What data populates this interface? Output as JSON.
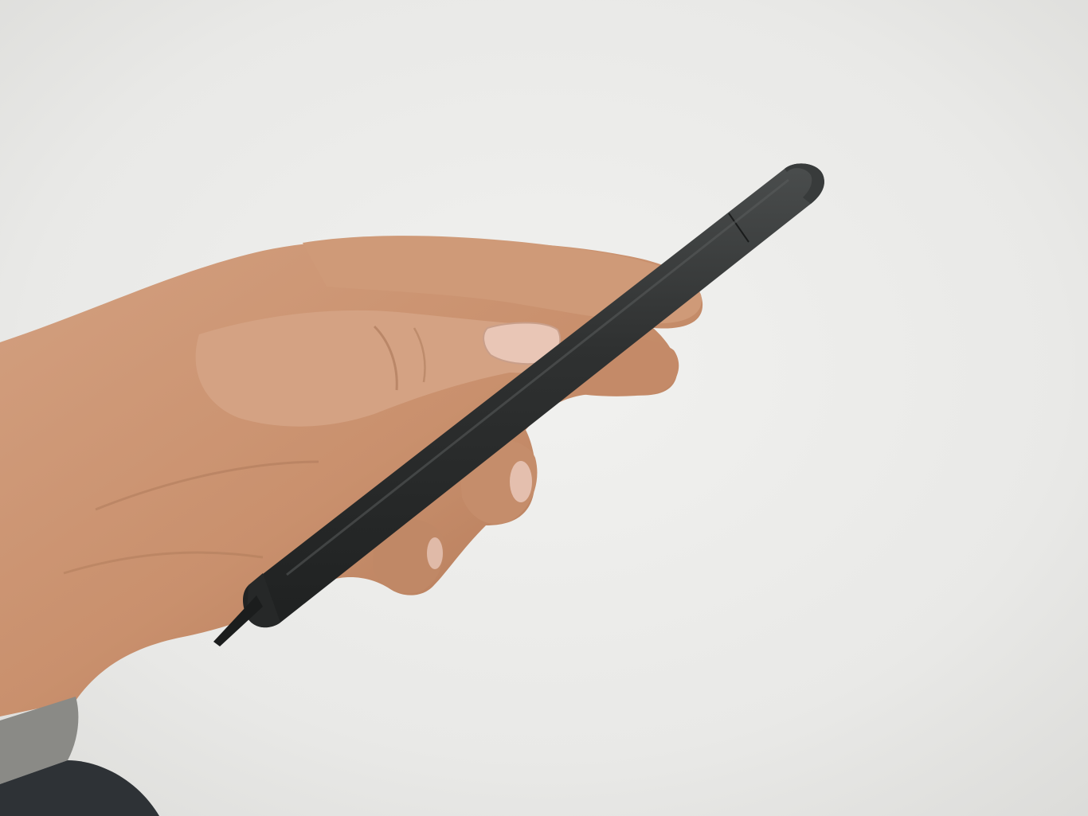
{
  "colors": {
    "background": "#e9e9e7",
    "background_light": "#f1f1ef",
    "background_shadow": "#d9d9d6",
    "skin": "#c9906d",
    "skin_shadow": "#a86e4e",
    "skin_highlight": "#dcae8f",
    "nail": "#e9c6b6",
    "pen_body": "#2f3131",
    "pen_highlight": "#4a4d4d",
    "pen_shadow": "#1f2121",
    "sleeve_band": "#8a8a86",
    "sleeve_fabric": "#2e3236"
  },
  "objects": [
    "hand",
    "stylus-pen",
    "shirt-sleeve"
  ]
}
